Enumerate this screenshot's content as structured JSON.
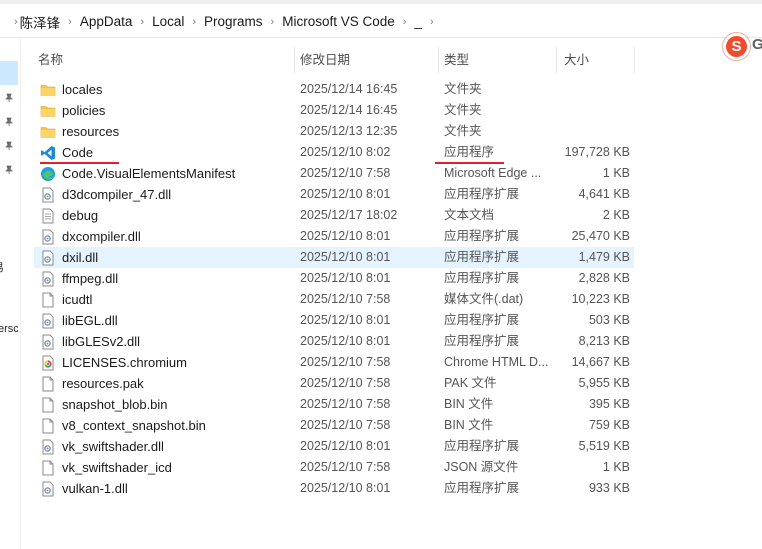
{
  "breadcrumb": {
    "lead": "›",
    "items": [
      "陈泽锋",
      "AppData",
      "Local",
      "Programs",
      "Microsoft VS Code",
      "_"
    ],
    "separator": "›"
  },
  "nav_fragments": [
    "易",
    "ersc"
  ],
  "columns": {
    "name": "名称",
    "date": "修改日期",
    "type": "类型",
    "size": "大小"
  },
  "files": [
    {
      "icon": "folder-icon",
      "name": "locales",
      "date": "2025/12/14 16:45",
      "type": "文件夹",
      "size": ""
    },
    {
      "icon": "folder-icon",
      "name": "policies",
      "date": "2025/12/14 16:45",
      "type": "文件夹",
      "size": ""
    },
    {
      "icon": "folder-icon",
      "name": "resources",
      "date": "2025/12/13 12:35",
      "type": "文件夹",
      "size": ""
    },
    {
      "icon": "vscode-icon",
      "name": "Code",
      "date": "2025/12/10 8:02",
      "type": "应用程序",
      "size": "197,728 KB"
    },
    {
      "icon": "edge-icon",
      "name": "Code.VisualElementsManifest",
      "date": "2025/12/10 7:58",
      "type": "Microsoft Edge ...",
      "size": "1 KB"
    },
    {
      "icon": "dll-icon",
      "name": "d3dcompiler_47.dll",
      "date": "2025/12/10 8:01",
      "type": "应用程序扩展",
      "size": "4,641 KB"
    },
    {
      "icon": "text-file-icon",
      "name": "debug",
      "date": "2025/12/17 18:02",
      "type": "文本文档",
      "size": "2 KB"
    },
    {
      "icon": "dll-icon",
      "name": "dxcompiler.dll",
      "date": "2025/12/10 8:01",
      "type": "应用程序扩展",
      "size": "25,470 KB"
    },
    {
      "icon": "dll-icon",
      "name": "dxil.dll",
      "date": "2025/12/10 8:01",
      "type": "应用程序扩展",
      "size": "1,479 KB"
    },
    {
      "icon": "dll-icon",
      "name": "ffmpeg.dll",
      "date": "2025/12/10 8:01",
      "type": "应用程序扩展",
      "size": "2,828 KB"
    },
    {
      "icon": "blank-file-icon",
      "name": "icudtl",
      "date": "2025/12/10 7:58",
      "type": "媒体文件(.dat)",
      "size": "10,223 KB"
    },
    {
      "icon": "dll-icon",
      "name": "libEGL.dll",
      "date": "2025/12/10 8:01",
      "type": "应用程序扩展",
      "size": "503 KB"
    },
    {
      "icon": "dll-icon",
      "name": "libGLESv2.dll",
      "date": "2025/12/10 8:01",
      "type": "应用程序扩展",
      "size": "8,213 KB"
    },
    {
      "icon": "chrome-icon",
      "name": "LICENSES.chromium",
      "date": "2025/12/10 7:58",
      "type": "Chrome HTML D...",
      "size": "14,667 KB"
    },
    {
      "icon": "blank-file-icon",
      "name": "resources.pak",
      "date": "2025/12/10 7:58",
      "type": "PAK 文件",
      "size": "5,955 KB"
    },
    {
      "icon": "blank-file-icon",
      "name": "snapshot_blob.bin",
      "date": "2025/12/10 7:58",
      "type": "BIN 文件",
      "size": "395 KB"
    },
    {
      "icon": "blank-file-icon",
      "name": "v8_context_snapshot.bin",
      "date": "2025/12/10 7:58",
      "type": "BIN 文件",
      "size": "759 KB"
    },
    {
      "icon": "dll-icon",
      "name": "vk_swiftshader.dll",
      "date": "2025/12/10 8:01",
      "type": "应用程序扩展",
      "size": "5,519 KB"
    },
    {
      "icon": "blank-file-icon",
      "name": "vk_swiftshader_icd",
      "date": "2025/12/10 7:58",
      "type": "JSON 源文件",
      "size": "1 KB"
    },
    {
      "icon": "dll-icon",
      "name": "vulkan-1.dll",
      "date": "2025/12/10 8:01",
      "type": "应用程序扩展",
      "size": "933 KB"
    }
  ],
  "selected_row": "dxil.dll",
  "colors": {
    "folder": "#f8c443",
    "vscode": "#1f8ad2",
    "select": "#e5f3ff",
    "annotation": "#e0202a",
    "ime": "#ee4d2d"
  },
  "ime": {
    "logo_letter": "S",
    "side_glyph": "G"
  }
}
